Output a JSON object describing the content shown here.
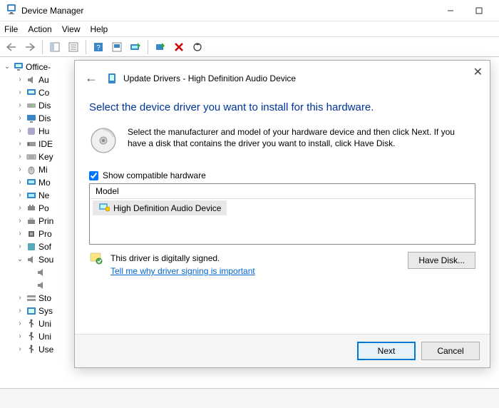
{
  "window": {
    "title": "Device Manager",
    "menu": {
      "file": "File",
      "action": "Action",
      "view": "View",
      "help": "Help"
    }
  },
  "tree": {
    "root": "Office-",
    "items": [
      {
        "label": "Au",
        "kind": "audio"
      },
      {
        "label": "Co",
        "kind": "computer"
      },
      {
        "label": "Dis",
        "kind": "disk"
      },
      {
        "label": "Dis",
        "kind": "display"
      },
      {
        "label": "Hu",
        "kind": "hid"
      },
      {
        "label": "IDE",
        "kind": "ide"
      },
      {
        "label": "Key",
        "kind": "keyboard"
      },
      {
        "label": "Mi",
        "kind": "mouse"
      },
      {
        "label": "Mo",
        "kind": "monitor"
      },
      {
        "label": "Ne",
        "kind": "network"
      },
      {
        "label": "Po",
        "kind": "port"
      },
      {
        "label": "Prin",
        "kind": "printer"
      },
      {
        "label": "Pro",
        "kind": "processor"
      },
      {
        "label": "Sof",
        "kind": "software"
      },
      {
        "label": "Sou",
        "kind": "audio",
        "expanded": true,
        "children": 2
      },
      {
        "label": "Sto",
        "kind": "storage"
      },
      {
        "label": "Sys",
        "kind": "system"
      },
      {
        "label": "Uni",
        "kind": "usb"
      },
      {
        "label": "Uni",
        "kind": "usb"
      },
      {
        "label": "Use",
        "kind": "usb"
      }
    ]
  },
  "dialog": {
    "title": "Update Drivers - High Definition Audio Device",
    "instruction": "Select the device driver you want to install for this hardware.",
    "description": "Select the manufacturer and model of your hardware device and then click Next. If you have a disk that contains the driver you want to install, click Have Disk.",
    "checkbox_label": "Show compatible hardware",
    "checkbox_checked": true,
    "model_header": "Model",
    "model_item": "High Definition Audio Device",
    "signed_text": "This driver is digitally signed.",
    "signed_link": "Tell me why driver signing is important",
    "have_disk": "Have Disk...",
    "next": "Next",
    "cancel": "Cancel"
  }
}
